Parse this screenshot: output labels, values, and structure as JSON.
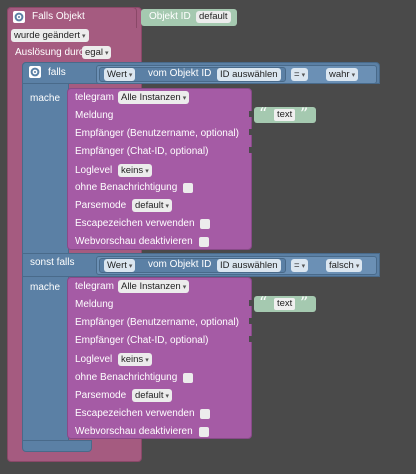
{
  "trigger": {
    "title": "Falls Objekt",
    "changed": "wurde geändert",
    "trigger_label": "Auslösung durch",
    "trigger_value": "egal",
    "object_id_label": "Objekt ID",
    "object_id_value": "default"
  },
  "if_block": {
    "falls_label": "falls",
    "mache_label": "mache",
    "sonst_falls_label": "sonst falls",
    "mache2_label": "mache"
  },
  "conditions": [
    {
      "wert": "Wert",
      "vom": "vom Objekt ID",
      "id_select": "ID auswählen",
      "op": "=",
      "value": "wahr"
    },
    {
      "wert": "Wert",
      "vom": "vom Objekt ID",
      "id_select": "ID auswählen",
      "op": "=",
      "value": "falsch"
    }
  ],
  "telegram_blocks": [
    {
      "title": "telegram",
      "instance": "Alle Instanzen",
      "meldung": "Meldung",
      "text_value": "text",
      "empf_user": "Empfänger (Benutzername, optional)",
      "empf_chat": "Empfänger (Chat-ID, optional)",
      "loglevel_label": "Loglevel",
      "loglevel_value": "keins",
      "ohne_benachrichtigung": "ohne Benachrichtigung",
      "parsemode_label": "Parsemode",
      "parsemode_value": "default",
      "escape_label": "Escapezeichen verwenden",
      "webvorschau_label": "Webvorschau deaktivieren"
    },
    {
      "title": "telegram",
      "instance": "Alle Instanzen",
      "meldung": "Meldung",
      "text_value": "text",
      "empf_user": "Empfänger (Benutzername, optional)",
      "empf_chat": "Empfänger (Chat-ID, optional)",
      "loglevel_label": "Loglevel",
      "loglevel_value": "keins",
      "ohne_benachrichtigung": "ohne Benachrichtigung",
      "parsemode_label": "Parsemode",
      "parsemode_value": "default",
      "escape_label": "Escapezeichen verwenden",
      "webvorschau_label": "Webvorschau deaktivieren"
    }
  ],
  "colors": {
    "trigger": "#a55b80",
    "logic": "#5b80a5",
    "telegram": "#a55ba5",
    "text": "#a5c9b0"
  },
  "icons": {
    "gear": "gear-icon",
    "dropdown": "▾"
  }
}
